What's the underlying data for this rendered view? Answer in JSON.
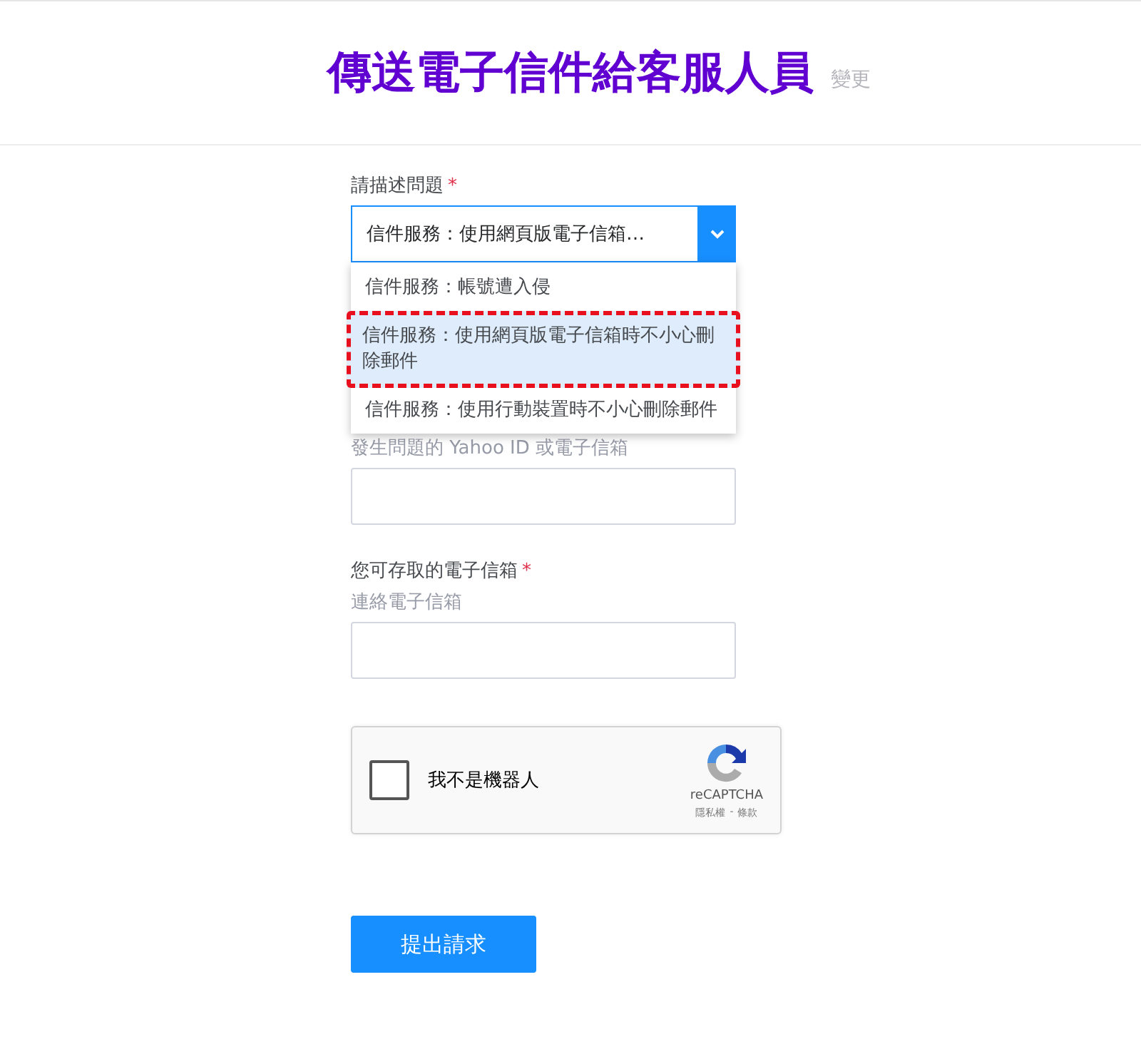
{
  "header": {
    "title": "傳送電子信件給客服人員",
    "change_link": "變更"
  },
  "problem": {
    "label": "請描述問題",
    "required_mark": "*",
    "value": "信件服務：使用網頁版電子信箱…",
    "expanded": true,
    "options": [
      {
        "label": "信件服務：帳號遭入侵",
        "selected": false
      },
      {
        "label": "信件服務：使用網頁版電子信箱時不小心刪除郵件",
        "selected": true
      },
      {
        "label": "信件服務：使用行動裝置時不小心刪除郵件",
        "selected": false
      }
    ]
  },
  "account": {
    "label": "發生問題的 Yahoo ID 或電子信箱"
  },
  "contact": {
    "label": "您可存取的電子信箱",
    "required_mark": "*",
    "hint": "連絡電子信箱"
  },
  "captcha": {
    "label": "我不是機器人",
    "checked": false,
    "brand": "reCAPTCHA",
    "privacy": "隱私權",
    "separator": "-",
    "terms": "條款"
  },
  "submit": "提出請求"
}
